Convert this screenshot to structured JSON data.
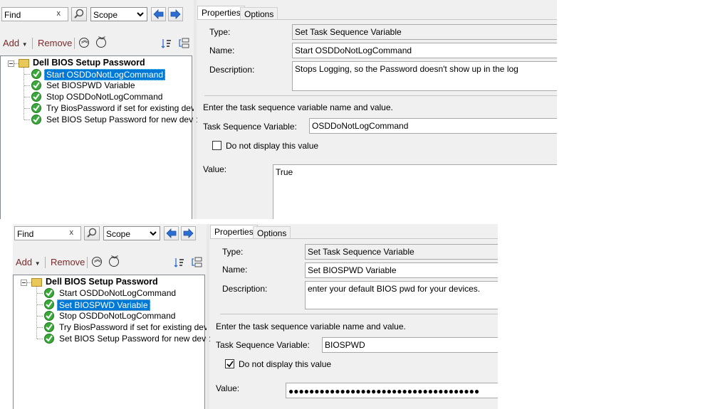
{
  "top": {
    "find_text": "Find",
    "clear_glyph": "x",
    "scope_value": "Scope",
    "add_label": "Add",
    "remove_label": "Remove",
    "tree": {
      "root": "Dell BIOS Setup Password",
      "items": [
        "Start OSDDoNotLogCommand",
        "Set BIOSPWD Variable",
        "Stop OSDDoNotLogCommand",
        "Try BiosPassword if set for existing devices",
        "Set BIOS Setup Password for new devices"
      ],
      "selected_index": 0
    },
    "tabs": [
      "Properties",
      "Options"
    ],
    "props": {
      "type_label": "Type:",
      "type_value": "Set Task Sequence Variable",
      "name_label": "Name:",
      "name_value": "Start OSDDoNotLogCommand",
      "desc_label": "Description:",
      "desc_value": "Stops Logging, so the Password doesn't show up in the log",
      "instruction": "Enter the task sequence variable name and value.",
      "tsv_label": "Task Sequence Variable:",
      "tsv_value": "OSDDoNotLogCommand",
      "hide_label": "Do not display this value",
      "hide_checked": false,
      "value_label": "Value:",
      "value_value": "True"
    }
  },
  "bottom": {
    "find_text": "Find",
    "clear_glyph": "x",
    "scope_value": "Scope",
    "add_label": "Add",
    "remove_label": "Remove",
    "tree": {
      "root": "Dell BIOS Setup Password",
      "items": [
        "Start OSDDoNotLogCommand",
        "Set BIOSPWD Variable",
        "Stop OSDDoNotLogCommand",
        "Try BiosPassword if set for existing devices",
        "Set BIOS Setup Password for new devices"
      ],
      "selected_index": 1
    },
    "tabs": [
      "Properties",
      "Options"
    ],
    "props": {
      "type_label": "Type:",
      "type_value": "Set Task Sequence Variable",
      "name_label": "Name:",
      "name_value": "Set BIOSPWD Variable",
      "desc_label": "Description:",
      "desc_value": "enter your default BIOS pwd for your devices.",
      "instruction": "Enter the task sequence variable name and value.",
      "tsv_label": "Task Sequence Variable:",
      "tsv_value": "BIOSPWD",
      "hide_label": "Do not display this value",
      "hide_checked": true,
      "value_label": "Value:",
      "value_value": "●●●●●●●●●●●●●●●●●●●●●●●●●●●●●●●●●●●●●"
    }
  },
  "colors": {
    "selection": "#0078d7",
    "check_green": "#3aa83a",
    "nav_arrow_blue": "#2d6fd0",
    "add_remove_text": "#7a2a2a"
  }
}
